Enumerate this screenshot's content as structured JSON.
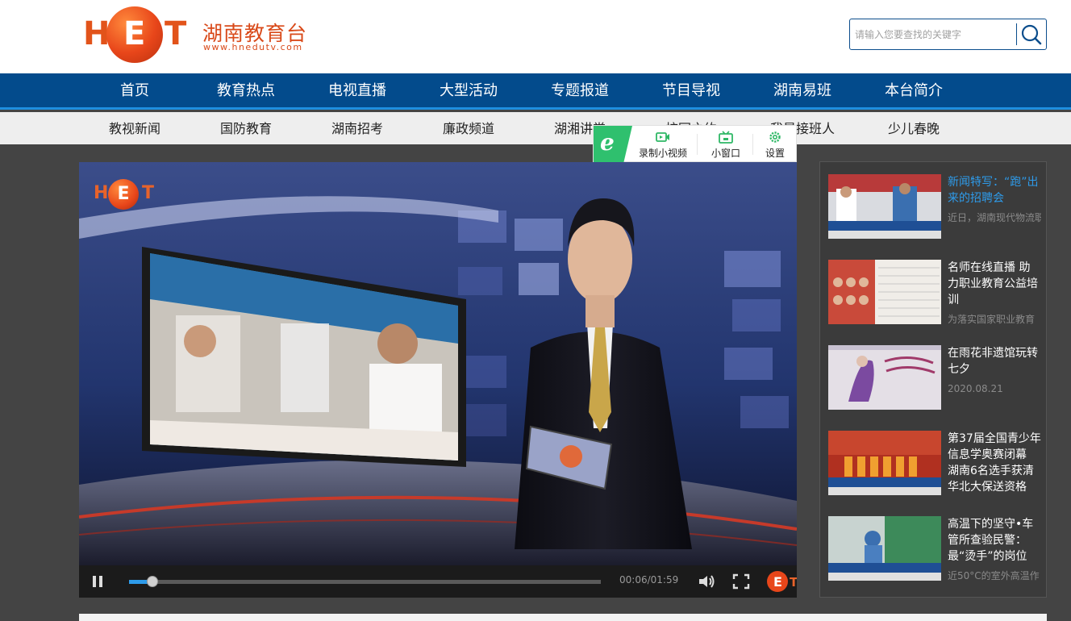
{
  "header": {
    "logo_letters": [
      "H",
      "E",
      "T"
    ],
    "brand_cn": "湖南教育台",
    "brand_url": "www.hnedutv.com",
    "search_placeholder": "请输入您要查找的关键字",
    "search_icon": "search-icon",
    "brand_color": "#e2531a"
  },
  "main_nav": {
    "bg_color": "#034b8c",
    "items": [
      "首页",
      "教育热点",
      "电视直播",
      "大型活动",
      "专题报道",
      "节目导视",
      "湖南易班",
      "本台简介"
    ]
  },
  "sub_nav": {
    "items": [
      "教视新闻",
      "国防教育",
      "湖南招考",
      "廉政频道",
      "湖湘讲堂",
      "校园之约",
      "我是接班人",
      "少儿春晚"
    ]
  },
  "float_toolbar": {
    "badge_icon": "browser-e-icon",
    "buttons": [
      {
        "label": "录制小视频",
        "icon": "record-video-icon"
      },
      {
        "label": "小窗口",
        "icon": "mini-window-icon"
      },
      {
        "label": "设置",
        "icon": "gear-icon"
      }
    ]
  },
  "player": {
    "state": "playing",
    "time_display": "00:06/01:59",
    "progress_fraction": 0.05,
    "watermark": "HET",
    "accent_color": "#2e9bea"
  },
  "news": [
    {
      "title": "新闻特写：“跑”出来的招聘会",
      "desc": "近日，湖南现代物流职院召开了一场特殊",
      "highlight": true
    },
    {
      "title": "名师在线直播 助力职业教育公益培训",
      "desc": "为落实国家职业教育",
      "highlight": false
    },
    {
      "title": "在雨花非遗馆玩转七夕",
      "desc": "2020.08.21",
      "highlight": false
    },
    {
      "title": "第37届全国青少年信息学奥赛闭幕 湖南6名选手获清华北大保送资格",
      "desc": "",
      "highlight": false
    },
    {
      "title": "高温下的坚守•车管所查验民警：最“烫手”的岗位",
      "desc": "近50°C的室外高温作",
      "highlight": false
    }
  ]
}
